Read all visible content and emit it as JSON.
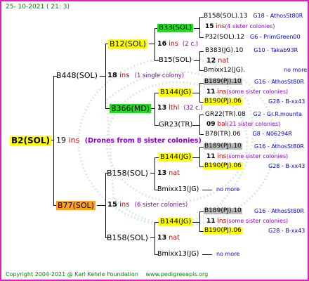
{
  "header": {
    "date": "25- 10-2021 ( 21: 3)"
  },
  "footer": {
    "copyright": "Copyright 2004-2021 @ Karl Kehrle Foundation",
    "website": "www.pedigreeapis.org"
  },
  "root": {
    "name": "B2(SOL)",
    "count": "19",
    "unit": "ins",
    "note": "(Drones from 8 sister colonies)"
  },
  "queen_b448": {
    "name": "B448(SOL)",
    "count": "18",
    "unit": "ins",
    "note": "(1 single colony)"
  },
  "queen_b77": {
    "name": "B77(SOL)",
    "count": "15",
    "unit": "ins",
    "note": "(6 sister colonies)"
  },
  "b12": {
    "name": "B12(SOL)",
    "count": "16",
    "unit": "ins",
    "note": "(2 c.)"
  },
  "b366": {
    "name": "B366(MD)",
    "count": "13",
    "unit": "lthl",
    "note": "(32 c.)"
  },
  "b158a": {
    "name": "B158(SOL)",
    "count": "13",
    "unit": "nat"
  },
  "b158b": {
    "name": "B158(SOL)",
    "count": "13",
    "unit": "nat"
  },
  "b33": {
    "name": "B33(SOL)",
    "count": "15",
    "unit": "ins",
    "note": "(4 sister colonies)",
    "top": "B158(SOL).13",
    "top_code": "G18 - AthosSt80R",
    "bottom": "P32(SOL).12",
    "bottom_code": "G6 - PrimGreen00"
  },
  "b15": {
    "name": "B15(SOL)",
    "count": "12",
    "unit": "nat",
    "top": "B383(JG).10",
    "top_code": "G10 - Takab93R",
    "bottom": "Bmixx12(JG).",
    "bottom_code": "no more"
  },
  "b144a": {
    "name": "B144(JG)",
    "count": "11",
    "unit": "ins",
    "note": "(some sister colonies)",
    "top": "B189(PJ).10",
    "top_code": "G16 - AthosSt80R",
    "bottom": "B190(PJ).06",
    "bottom_code": "G28 - B-xx43"
  },
  "gr23": {
    "name": "GR23(TR)",
    "count": "09",
    "unit": "bal",
    "note": "(21 sister colonies)",
    "top": "GR22(TR).08",
    "top_code": "G2 - Gr.R.mounta",
    "bottom": "B78(TR).06",
    "bottom_code": "G8 - N06294R"
  },
  "b144b": {
    "name": "B144(JG)",
    "count": "11",
    "unit": "ins",
    "note": "(some sister colonies)",
    "top": "B189(PJ).10",
    "top_code": "G16 - AthosSt80R",
    "bottom": "B190(PJ).06",
    "bottom_code": "G28 - B-xx43"
  },
  "bmixx13a": {
    "name": "Bmixx13(JG)",
    "code": "no more"
  },
  "b144c": {
    "name": "B144(JG)",
    "count": "11",
    "unit": "ins",
    "note": "(some sister colonies)",
    "top": "B189(PJ).10",
    "top_code": "G16 - AthosSt80R",
    "bottom": "B190(PJ).06",
    "bottom_code": "G28 - B-xx43"
  },
  "bmixx13b": {
    "name": "Bmixx13(JG)",
    "code": "no more"
  },
  "colors": {
    "border": "#e020c0",
    "yellow": "#ffff00",
    "green": "#22dd22",
    "orange": "#ffa020",
    "gray": "#b8b8b8"
  }
}
